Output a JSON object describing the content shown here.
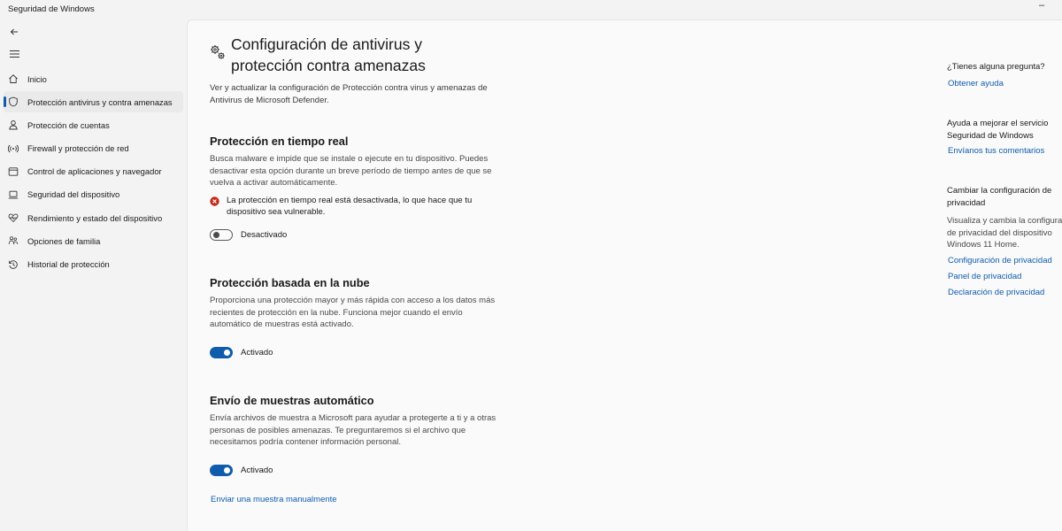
{
  "window": {
    "title": "Seguridad de Windows",
    "minimize_glyph": "–"
  },
  "sidebar": {
    "back_icon": "back-arrow-icon",
    "menu_icon": "hamburger-icon",
    "items": [
      {
        "label": "Inicio",
        "icon": "home-icon"
      },
      {
        "label": "Protección antivirus y contra amenazas",
        "icon": "shield-icon",
        "active": true
      },
      {
        "label": "Protección de cuentas",
        "icon": "person-icon"
      },
      {
        "label": "Firewall y protección de red",
        "icon": "wifi-icon"
      },
      {
        "label": "Control de aplicaciones y navegador",
        "icon": "browser-icon"
      },
      {
        "label": "Seguridad del dispositivo",
        "icon": "laptop-icon"
      },
      {
        "label": "Rendimiento y estado del dispositivo",
        "icon": "heart-icon"
      },
      {
        "label": "Opciones de familia",
        "icon": "family-icon"
      },
      {
        "label": "Historial de protección",
        "icon": "history-icon"
      }
    ]
  },
  "main": {
    "icon": "gears-icon",
    "title": "Configuración de antivirus y protección contra amenazas",
    "description": "Ver y actualizar la configuración de Protección contra virus y amenazas de Antivirus de Microsoft Defender.",
    "realtime": {
      "heading": "Protección en tiempo real",
      "text": "Busca malware e impide que se instale o ejecute en tu dispositivo. Puedes desactivar esta opción durante un breve período de tiempo antes de que se vuelva a activar automáticamente.",
      "warning": "La protección en tiempo real está desactivada, lo que hace que tu dispositivo sea vulnerable.",
      "toggle_label": "Desactivado",
      "toggle_on": false
    },
    "cloud": {
      "heading": "Protección basada en la nube",
      "text": "Proporciona una protección mayor y más rápida con acceso a los datos más recientes de protección en la nube. Funciona mejor cuando el envío automático de muestras está activado.",
      "toggle_label": "Activado",
      "toggle_on": true
    },
    "samples": {
      "heading": "Envío de muestras automático",
      "text": "Envía archivos de muestra a Microsoft para ayudar a protegerte a ti y a otras personas de posibles amenazas. Te preguntaremos si el archivo que necesitamos podría contener información personal.",
      "toggle_label": "Activado",
      "toggle_on": true
    },
    "manual_link": "Enviar una muestra manualmente"
  },
  "right": {
    "question": "¿Tienes alguna pregunta?",
    "help_link": "Obtener ayuda",
    "improve_line1": "Ayuda a mejorar el servicio",
    "improve_line2": "Seguridad de Windows",
    "feedback_link": "Envíanos tus comentarios",
    "privacy_heading_line1": "Cambiar la configuración de",
    "privacy_heading_line2": "privacidad",
    "privacy_text_line1": "Visualiza y cambia la configuración",
    "privacy_text_line2": "de privacidad del dispositivo",
    "privacy_text_line3": "Windows 11 Home.",
    "privacy_link1": "Configuración de privacidad",
    "privacy_link2": "Panel de privacidad",
    "privacy_link3": "Declaración de privacidad"
  },
  "colors": {
    "accent": "#0f5cad",
    "error": "#c42b1c"
  }
}
